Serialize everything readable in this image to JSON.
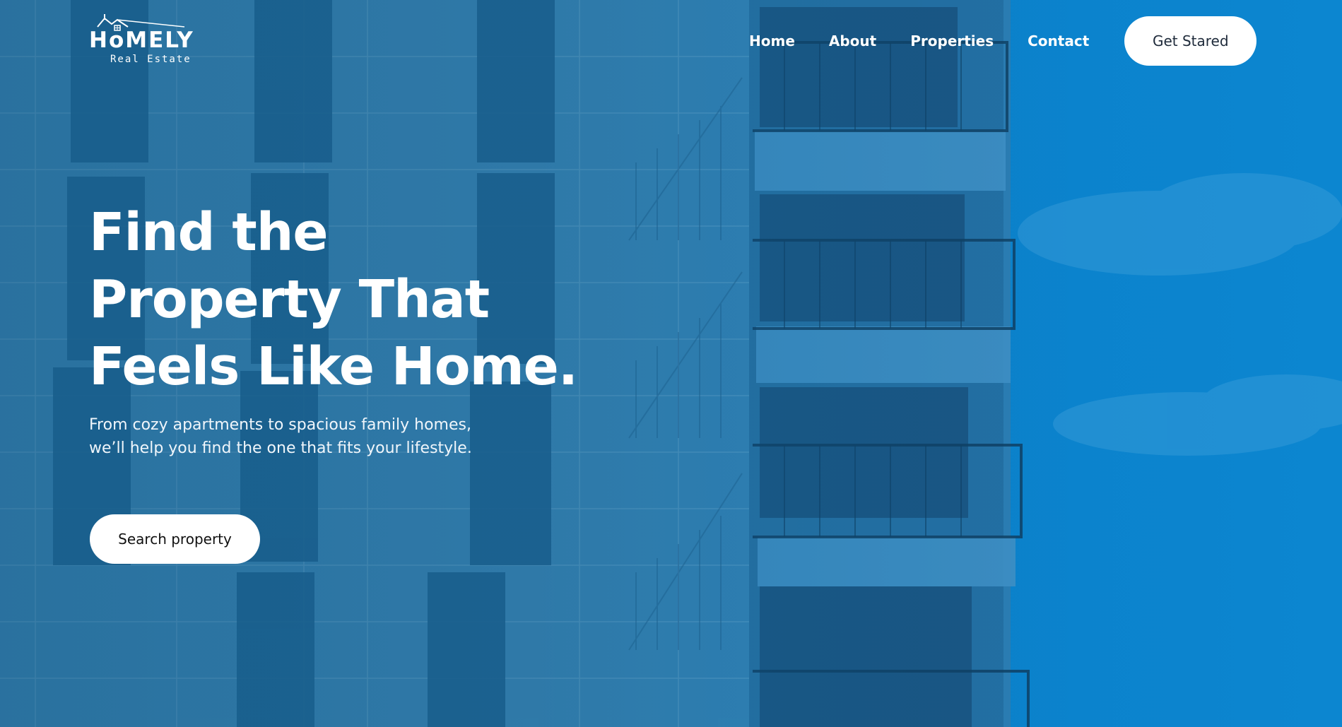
{
  "brand": {
    "name": "HoMELY",
    "tagline": "Real Estate"
  },
  "nav": {
    "items": [
      {
        "label": "Home"
      },
      {
        "label": "About"
      },
      {
        "label": "Properties"
      },
      {
        "label": "Contact"
      }
    ],
    "cta_label": "Get Stared"
  },
  "hero": {
    "headline_lines": [
      "Find the",
      "Property That",
      "Feels Like Home."
    ],
    "subtext": "From cozy apartments to spacious family homes, we’ll help you find the one that fits your lifestyle.",
    "search_button_label": "Search property"
  },
  "colors": {
    "overlay_blue": "#1f78b4",
    "sky_blue": "#0c86d0",
    "button_bg": "#ffffff",
    "text": "#ffffff"
  }
}
